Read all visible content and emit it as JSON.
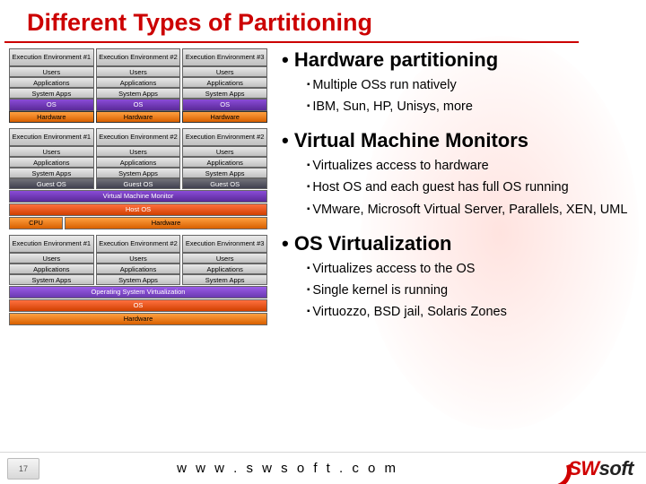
{
  "title": "Different Types of Partitioning",
  "diag1": {
    "cols": [
      {
        "env": "Execution Environment #1",
        "layers": [
          "Users",
          "Applications",
          "System Apps"
        ],
        "os": "OS",
        "hw": "Hardware"
      },
      {
        "env": "Execution Environment #2",
        "layers": [
          "Users",
          "Applications",
          "System Apps"
        ],
        "os": "OS",
        "hw": "Hardware"
      },
      {
        "env": "Execution Environment #3",
        "layers": [
          "Users",
          "Applications",
          "System Apps"
        ],
        "os": "OS",
        "hw": "Hardware"
      }
    ]
  },
  "diag2": {
    "cols": [
      {
        "env": "Execution Environment #1",
        "layers": [
          "Users",
          "Applications",
          "System Apps"
        ],
        "guest": "Guest OS"
      },
      {
        "env": "Execution Environment #2",
        "layers": [
          "Users",
          "Applications",
          "System Apps"
        ],
        "guest": "Guest OS"
      },
      {
        "env": "Execution Environment #2",
        "layers": [
          "Users",
          "Applications",
          "System Apps"
        ],
        "guest": "Guest OS"
      }
    ],
    "vmm": "Virtual Machine Monitor",
    "hostos": "Host OS",
    "cpu": "CPU",
    "hw": "Hardware"
  },
  "diag3": {
    "cols": [
      {
        "env": "Execution Environment #1",
        "layers": [
          "Users",
          "Applications",
          "System Apps"
        ]
      },
      {
        "env": "Execution Environment #2",
        "layers": [
          "Users",
          "Applications",
          "System Apps"
        ]
      },
      {
        "env": "Execution Environment #3",
        "layers": [
          "Users",
          "Applications",
          "System Apps"
        ]
      }
    ],
    "osv": "Operating System Virtualization",
    "os": "OS",
    "hw": "Hardware"
  },
  "bullets": {
    "s1": {
      "title": "Hardware partitioning",
      "items": [
        "Multiple OSs run natively",
        "IBM, Sun, HP, Unisys, more"
      ]
    },
    "s2": {
      "title": "Virtual Machine Monitors",
      "items": [
        "Virtualizes access to hardware",
        "Host OS and each guest has full OS running",
        "VMware, Microsoft Virtual Server, Parallels, XEN, UML"
      ]
    },
    "s3": {
      "title": "OS Virtualization",
      "items": [
        "Virtualizes access to the OS",
        "Single kernel is running",
        "Virtuozzo, BSD jail, Solaris Zones"
      ]
    }
  },
  "footer": {
    "slide_no": "17",
    "url": "w w w . s w s o f t . c o m",
    "logo_a": "SW",
    "logo_b": "soft"
  }
}
